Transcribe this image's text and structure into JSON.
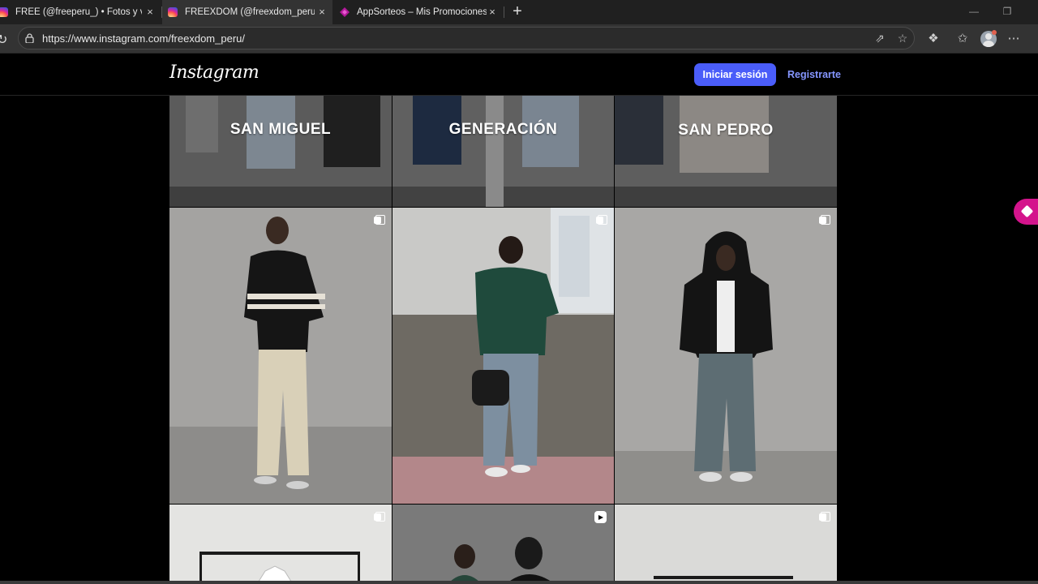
{
  "browser": {
    "tabs": [
      {
        "label": "FREE (@freeperu_) • Fotos y videos",
        "icon": "instagram-icon",
        "active": false
      },
      {
        "label": "FREEXDOM (@freexdom_peru) • Fotos y videos",
        "icon": "instagram-icon",
        "active": true
      },
      {
        "label": "AppSorteos – Mis Promociones",
        "icon": "appsorteos-icon",
        "active": false
      }
    ],
    "url": "https://www.instagram.com/freexdom_peru/",
    "new_tab": "+",
    "close_glyph": "×"
  },
  "header": {
    "logo": "Instagram",
    "login_label": "Iniciar sesión",
    "signup_label": "Registrarte"
  },
  "grid": {
    "banners": [
      "SAN MIGUEL",
      "GENERACIÓN",
      "SAN PEDRO"
    ],
    "posts": [
      {
        "type": "carousel"
      },
      {
        "type": "carousel"
      },
      {
        "type": "carousel"
      },
      {
        "type": "carousel"
      },
      {
        "type": "reel"
      },
      {
        "type": "carousel"
      }
    ]
  },
  "colors": {
    "accent": "#4a5df9",
    "link": "#8596ff",
    "extension": "#d4148c"
  }
}
